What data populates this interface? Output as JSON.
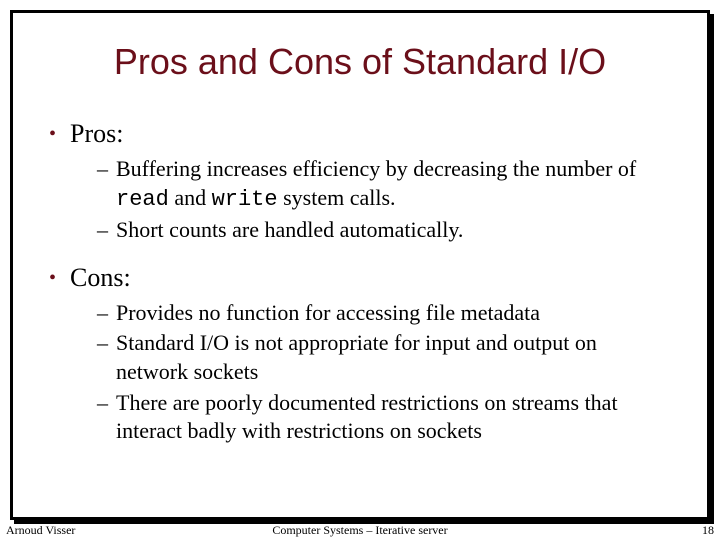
{
  "title": "Pros and Cons of Standard I/O",
  "pros": {
    "label": "Pros:",
    "items": [
      {
        "pre": "Buffering increases efficiency by decreasing the number of ",
        "code1": "read",
        "mid": " and ",
        "code2": "write",
        "post": " system calls."
      },
      {
        "text": "Short counts are handled automatically."
      }
    ]
  },
  "cons": {
    "label": "Cons:",
    "items": [
      {
        "text": "Provides no function for accessing file metadata"
      },
      {
        "text": "Standard I/O is not appropriate for input and output on network sockets"
      },
      {
        "text": "There are poorly documented restrictions on streams that interact badly with restrictions on sockets"
      }
    ]
  },
  "footer": {
    "left": "Arnoud Visser",
    "center": "Computer Systems – Iterative server",
    "right": "18"
  }
}
